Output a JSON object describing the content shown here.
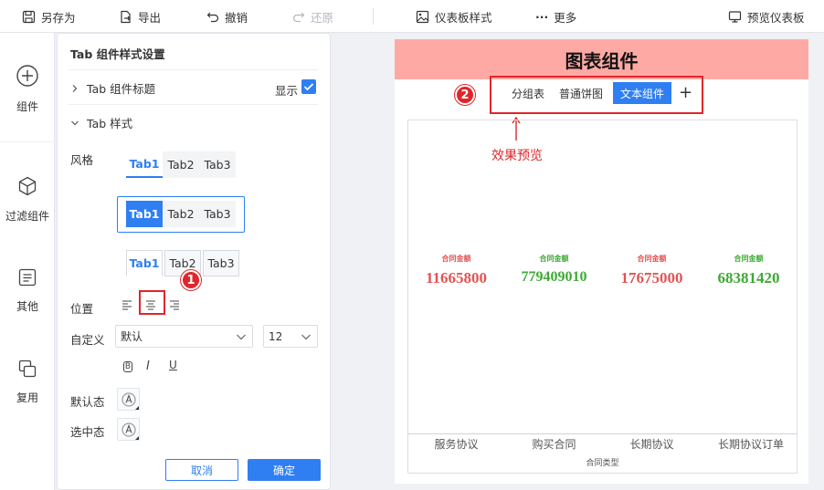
{
  "toolbar": {
    "save_as": "另存为",
    "export": "导出",
    "undo": "撤销",
    "redo": "还原",
    "dashboard_style": "仪表板样式",
    "more": "更多",
    "preview_dashboard": "预览仪表板"
  },
  "rail": {
    "items": [
      {
        "label": "组件",
        "icon": "plus-circle-icon"
      },
      {
        "label": "过滤组件",
        "icon": "cube-icon"
      },
      {
        "label": "其他",
        "icon": "document-icon"
      },
      {
        "label": "复用",
        "icon": "reuse-icon"
      }
    ]
  },
  "panel": {
    "title": "Tab 组件样式设置",
    "tab_title_section": "Tab 组件标题",
    "show_label": "显示",
    "show_checked": true,
    "tab_style_section": "Tab 样式",
    "style_label": "风格",
    "tabs": [
      "Tab1",
      "Tab2",
      "Tab3"
    ],
    "position_label": "位置",
    "custom_label": "自定义",
    "font_family_value": "默认",
    "font_size_value": "12",
    "bold_label": "B",
    "italic_label": "I",
    "underline_label": "U",
    "default_state_label": "默认态",
    "selected_state_label": "选中态",
    "cancel_label": "取消",
    "confirm_label": "确定",
    "accent_color": "#2f7ff3"
  },
  "preview": {
    "title": "图表组件",
    "title_bg": "#ffa9a4",
    "tabs": [
      {
        "label": "分组表",
        "active": false
      },
      {
        "label": "普通饼图",
        "active": false
      },
      {
        "label": "文本组件",
        "active": true
      }
    ],
    "add_tab": "+",
    "effect_note": "效果预览",
    "kpis": [
      {
        "label": "合同金额",
        "value": "11665800",
        "color": "#e05555"
      },
      {
        "label": "合同金额",
        "value": "779409010",
        "color": "#3fa936"
      },
      {
        "label": "合同金额",
        "value": "17675000",
        "color": "#e05555"
      },
      {
        "label": "合同金额",
        "value": "68381420",
        "color": "#3fa936"
      }
    ],
    "categories": [
      "服务协议",
      "购买合同",
      "长期协议",
      "长期协议订单"
    ],
    "axis_title": "合同类型"
  },
  "annotations": {
    "badge_1": "1",
    "badge_2": "2",
    "color": "#e0262a"
  }
}
